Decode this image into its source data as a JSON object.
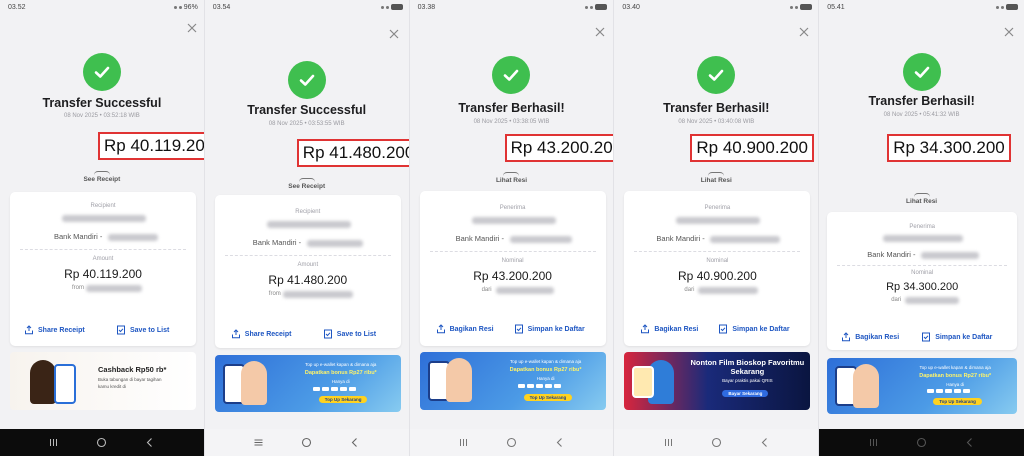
{
  "colors": {
    "success_green": "#3fbf4f",
    "highlight_red": "#e03333",
    "action_blue": "#1e56c2"
  },
  "panels": [
    {
      "status": {
        "time": "03.52",
        "right": "96%"
      },
      "title": "Transfer Successful",
      "datetime": "08 Nov 2025 • 03:52:18 WIB",
      "amount": "Rp 40.119.200",
      "receipt_toggle": "See Receipt",
      "recipient_label": "Recipient",
      "bank": "Bank Mandiri -",
      "amount_label": "Amount",
      "card_amount": "Rp 40.119.200",
      "from_label": "from",
      "share_label": "Share Receipt",
      "save_label": "Save to List",
      "banner": {
        "title": "Cashback Rp50 rb*",
        "line1": "Buka tabungan di bayar tagihan",
        "line2": "kamu kredit di"
      }
    },
    {
      "status": {
        "time": "03.54"
      },
      "title": "Transfer Successful",
      "datetime": "08 Nov 2025 • 03:53:55 WIB",
      "amount": "Rp 41.480.200",
      "receipt_toggle": "See Receipt",
      "recipient_label": "Recipient",
      "bank": "Bank Mandiri -",
      "amount_label": "Amount",
      "card_amount": "Rp 41.480.200",
      "from_label": "from",
      "share_label": "Share Receipt",
      "save_label": "Save to List",
      "banner": {
        "line1": "Top up e-wallet kapan & dimana aja",
        "title": "Dapatkan bonus Rp27 ribu*",
        "line2": "Hanya di",
        "cta": "Top Up Sekarang"
      }
    },
    {
      "status": {
        "time": "03.38"
      },
      "title": "Transfer Berhasil!",
      "datetime": "08 Nov 2025 • 03:38:05 WIB",
      "amount": "Rp 43.200.200",
      "receipt_toggle": "Lihat Resi",
      "recipient_label": "Penerima",
      "bank": "Bank Mandiri -",
      "amount_label": "Nominal",
      "card_amount": "Rp 43.200.200",
      "from_label": "dari",
      "share_label": "Bagikan Resi",
      "save_label": "Simpan ke Daftar",
      "banner": {
        "line1": "Top up e-wallet kapan & dimana aja",
        "title": "Dapatkan bonus Rp27 ribu*",
        "line2": "Hanya di",
        "cta": "Top Up Sekarang"
      }
    },
    {
      "status": {
        "time": "03.40"
      },
      "title": "Transfer Berhasil!",
      "datetime": "08 Nov 2025 • 03:40:08 WIB",
      "amount": "Rp 40.900.200",
      "receipt_toggle": "Lihat Resi",
      "recipient_label": "Penerima",
      "bank": "Bank Mandiri -",
      "amount_label": "Nominal",
      "card_amount": "Rp 40.900.200",
      "from_label": "dari",
      "share_label": "Bagikan Resi",
      "save_label": "Simpan ke Daftar",
      "banner": {
        "title": "Nonton Film Bioskop Favoritmu Sekarang",
        "line1": "Bayar praktis pakai QRIS",
        "cta": "Bayar Sekarang"
      }
    },
    {
      "status": {
        "time": "05.41"
      },
      "title": "Transfer Berhasil!",
      "datetime": "08 Nov 2025 • 05:41:32 WIB",
      "amount": "Rp 34.300.200",
      "receipt_toggle": "Lihat Resi",
      "recipient_label": "Penerima",
      "bank": "Bank Mandiri -",
      "amount_label": "Nominal",
      "card_amount": "Rp 34.300.200",
      "from_label": "dari",
      "share_label": "Bagikan Resi",
      "save_label": "Simpan ke Daftar",
      "banner": {
        "line1": "Top up e-wallet kapan & dimana aja",
        "title": "Dapatkan bonus Rp27 ribu*",
        "line2": "Hanya di",
        "cta": "Top Up Sekarang"
      }
    }
  ]
}
